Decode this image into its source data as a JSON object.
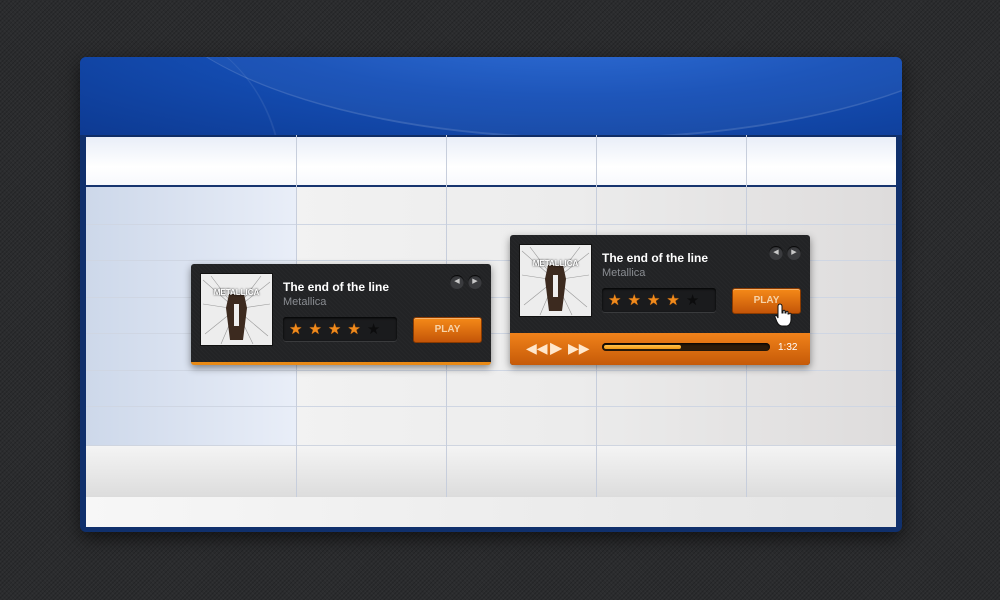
{
  "players": [
    {
      "title": "The end of the line",
      "artist": "Metallica",
      "rating": 4,
      "rating_max": 5,
      "play_label": "PLAY",
      "album_text": "METALLICA"
    },
    {
      "title": "The end of the line",
      "artist": "Metallica",
      "rating": 4,
      "rating_max": 5,
      "play_label": "PLAY",
      "album_text": "METALLICA",
      "progress_fraction": 0.47,
      "elapsed": "1:32"
    }
  ],
  "colors": {
    "accent": "#f08a1c",
    "banner": "#1550b8",
    "player_bg": "#222325"
  },
  "icons": {
    "prev": "chevron-left-icon",
    "next": "chevron-right-icon",
    "rewind": "rewind-icon",
    "play": "play-icon",
    "forward": "fast-forward-icon"
  }
}
